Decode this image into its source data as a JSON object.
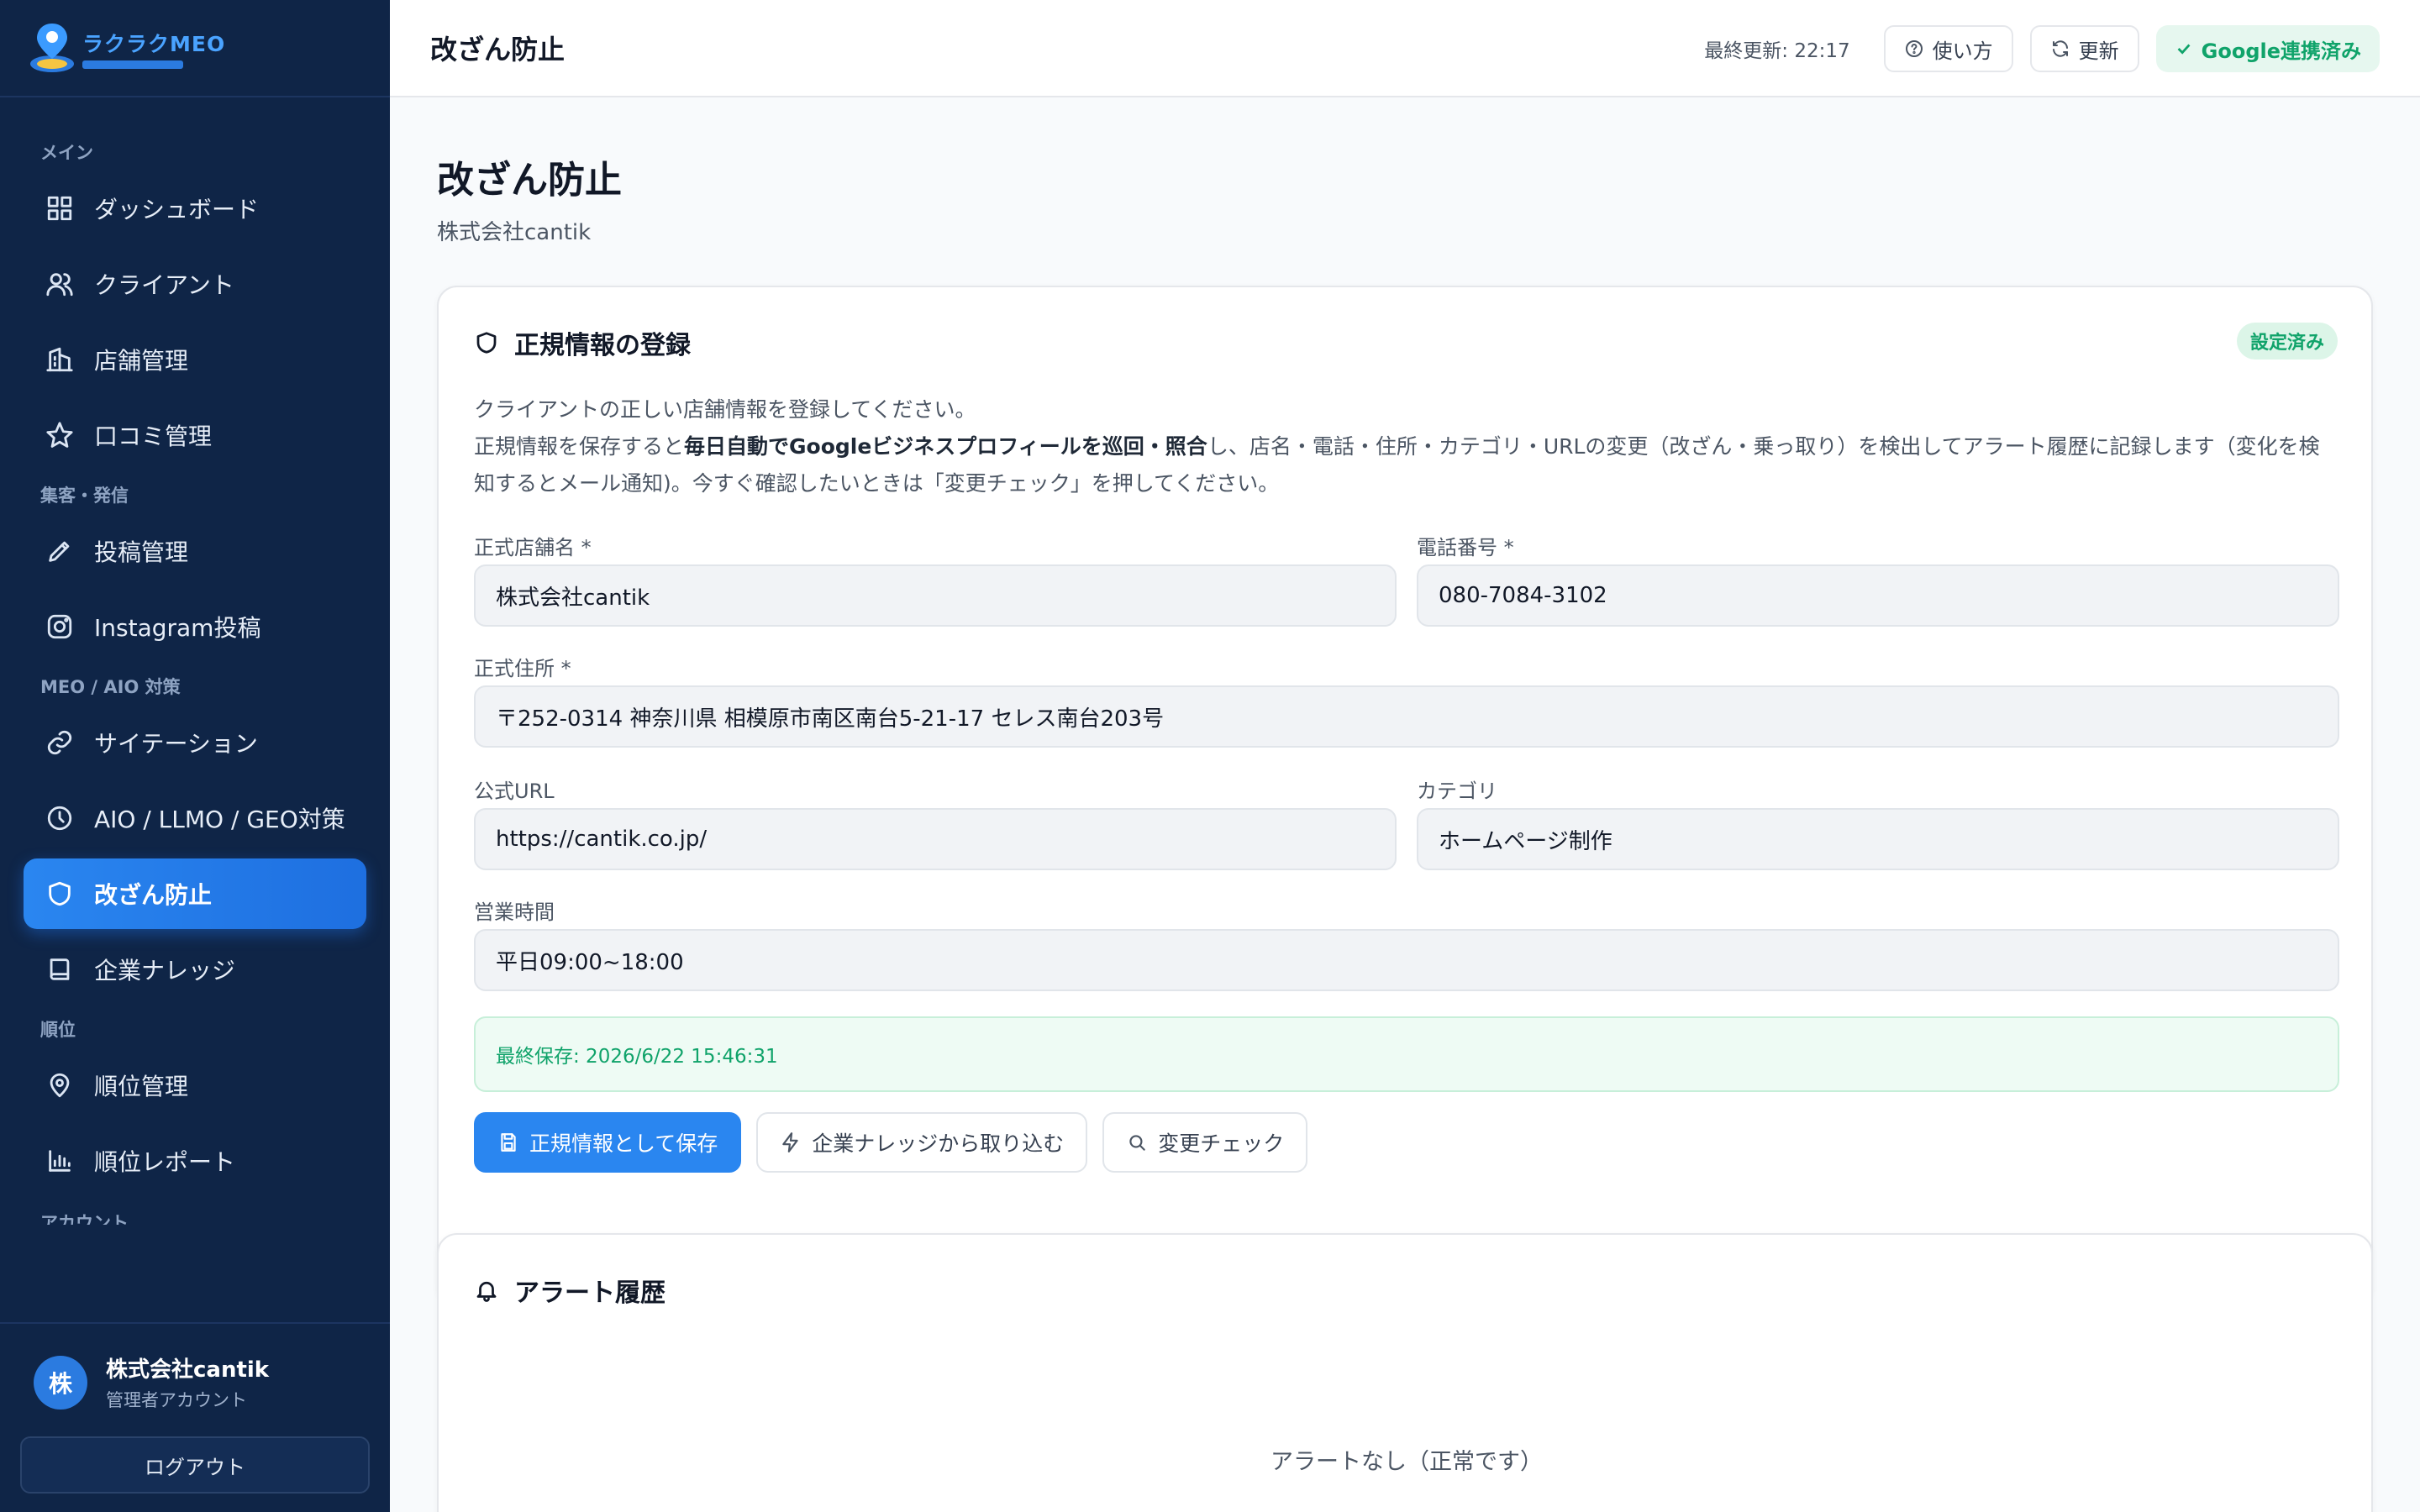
{
  "brand": {
    "name": "ラクラクMEO"
  },
  "sidebar": {
    "sections": [
      {
        "title": "メイン",
        "items": [
          {
            "label": "ダッシュボード",
            "icon": "grid-icon"
          },
          {
            "label": "クライアント",
            "icon": "users-icon"
          },
          {
            "label": "店舗管理",
            "icon": "building-icon"
          },
          {
            "label": "口コミ管理",
            "icon": "star-icon"
          }
        ]
      },
      {
        "title": "集客・発信",
        "items": [
          {
            "label": "投稿管理",
            "icon": "pen-icon"
          },
          {
            "label": "Instagram投稿",
            "icon": "instagram-icon"
          }
        ]
      },
      {
        "title": "MEO / AIO 対策",
        "items": [
          {
            "label": "サイテーション",
            "icon": "link-icon"
          },
          {
            "label": "AIO / LLMO / GEO対策",
            "icon": "clock-icon"
          },
          {
            "label": "改ざん防止",
            "icon": "shield-icon",
            "active": true
          },
          {
            "label": "企業ナレッジ",
            "icon": "book-icon"
          }
        ]
      },
      {
        "title": "順位",
        "items": [
          {
            "label": "順位管理",
            "icon": "location-pin-icon"
          },
          {
            "label": "順位レポート",
            "icon": "bar-chart-icon"
          }
        ]
      },
      {
        "title": "アカウント",
        "items": []
      }
    ],
    "user": {
      "avatar": "株",
      "name": "株式会社cantik",
      "role": "管理者アカウント"
    },
    "logout_label": "ログアウト"
  },
  "topbar": {
    "title": "改ざん防止",
    "last_update": "最終更新: 22:17",
    "help_label": "使い方",
    "refresh_label": "更新",
    "google_badge": "Google連携済み"
  },
  "page": {
    "title": "改ざん防止",
    "subtitle": "株式会社cantik"
  },
  "registration": {
    "title": "正規情報の登録",
    "status": "設定済み",
    "desc_line1": "クライアントの正しい店舗情報を登録してください。",
    "desc_line2_pre": "正規情報を保存すると",
    "desc_line2_bold": "毎日自動でGoogleビジネスプロフィールを巡回・照合",
    "desc_line2_post": "し、店名・電話・住所・カテゴリ・URLの変更（改ざん・乗っ取り）を検出してアラート履歴に記録します（変化を検知するとメール通知)。今すぐ確認したいときは「変更チェック」を押してください。",
    "fields": {
      "store_name": {
        "label": "正式店舗名 *",
        "value": "株式会社cantik"
      },
      "phone": {
        "label": "電話番号 *",
        "value": "080-7084-3102"
      },
      "address": {
        "label": "正式住所 *",
        "value": "〒252-0314 神奈川県 相模原市南区南台5-21-17 セレス南台203号"
      },
      "url": {
        "label": "公式URL",
        "value": "https://cantik.co.jp/"
      },
      "category": {
        "label": "カテゴリ",
        "value": "ホームページ制作"
      },
      "hours": {
        "label": "営業時間",
        "value": "平日09:00~18:00"
      }
    },
    "last_saved": "最終保存: 2026/6/22 15:46:31",
    "buttons": {
      "save": "正規情報として保存",
      "import": "企業ナレッジから取り込む",
      "check": "変更チェック"
    }
  },
  "alerts": {
    "title": "アラート履歴",
    "empty": "アラートなし（正常です）"
  },
  "colors": {
    "sidebar_bg": "#0f2547",
    "accent": "#2a86f0",
    "success": "#10a36a"
  }
}
